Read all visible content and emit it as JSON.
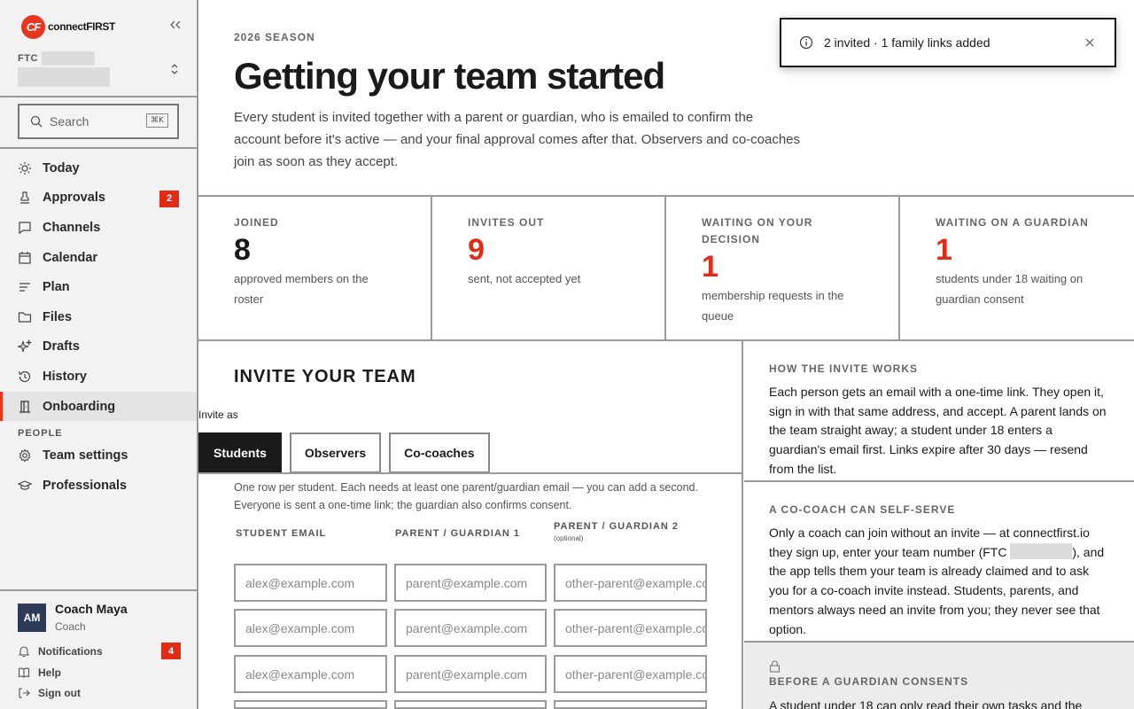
{
  "brand": {
    "name": "connectFIRST",
    "mark": "CF"
  },
  "team": {
    "code": "FTC"
  },
  "search": {
    "placeholder": "Search",
    "shortcut": "⌘K"
  },
  "nav": {
    "items": [
      {
        "label": "Today",
        "icon": "sun-icon"
      },
      {
        "label": "Approvals",
        "icon": "stamp-icon",
        "badge": "2"
      },
      {
        "label": "Channels",
        "icon": "chat-icon"
      },
      {
        "label": "Calendar",
        "icon": "calendar-icon"
      },
      {
        "label": "Plan",
        "icon": "list-icon"
      },
      {
        "label": "Files",
        "icon": "folder-icon"
      },
      {
        "label": "Drafts",
        "icon": "sparkle-icon"
      },
      {
        "label": "History",
        "icon": "history-icon"
      },
      {
        "label": "Onboarding",
        "icon": "door-icon",
        "active": true
      }
    ],
    "people_section": "PEOPLE",
    "people_items": [
      {
        "label": "Team settings",
        "icon": "gear-icon"
      },
      {
        "label": "Professionals",
        "icon": "graduation-cap-icon"
      }
    ]
  },
  "user": {
    "initials": "AM",
    "name": "Coach Maya",
    "role": "Coach"
  },
  "utility": {
    "notifications": {
      "label": "Notifications",
      "badge": "4"
    },
    "help": "Help",
    "sign_out": "Sign out"
  },
  "page": {
    "season": "2026 SEASON",
    "title": "Getting your team started",
    "intro": "Every student is invited together with a parent or guardian, who is emailed to confirm the account before it's active — and your final approval comes after that. Observers and co-coaches join as soon as they accept."
  },
  "toast": {
    "message": "2 invited · 1 family links added"
  },
  "stats": [
    {
      "label": "JOINED",
      "value": "8",
      "desc": "approved members on the roster",
      "highlight": false
    },
    {
      "label": "INVITES OUT",
      "value": "9",
      "desc": "sent, not accepted yet",
      "highlight": true
    },
    {
      "label": "WAITING ON YOUR DECISION",
      "value": "1",
      "desc": "membership requests in the queue",
      "highlight": true
    },
    {
      "label": "WAITING ON A GUARDIAN",
      "value": "1",
      "desc": "students under 18 waiting on guardian consent",
      "highlight": true
    }
  ],
  "invite": {
    "title": "INVITE YOUR TEAM",
    "invite_as": "Invite as",
    "tabs": [
      "Students",
      "Observers",
      "Co-coaches"
    ],
    "active_tab": "Students",
    "help": "One row per student. Each needs at least one parent/guardian email — you can add a second. Everyone is sent a one-time link; the guardian also confirms consent.",
    "columns": [
      "STUDENT EMAIL",
      "PARENT / GUARDIAN 1",
      "PARENT / GUARDIAN 2"
    ],
    "optional_note": "(optional)",
    "placeholders": {
      "student": "alex@example.com",
      "guardian1": "parent@example.com",
      "guardian2": "other-parent@example.com"
    }
  },
  "side": {
    "how_title": "HOW THE INVITE WORKS",
    "how_text": "Each person gets an email with a one-time link. They open it, sign in with that same address, and accept. A parent lands on the team straight away; a student under 18 enters a guardian's email first. Links expire after 30 days — resend from the list.",
    "cocoach_title": "A CO-COACH CAN SELF-SERVE",
    "cocoach_text_1": "Only a coach can join without an invite — at connectfirst.io they sign up, enter your team number (FTC",
    "cocoach_text_2": "), and the app tells them your team is already claimed and to ask you for a co-coach invite instead. Students, parents, and mentors always need an invite from you; they never see that option.",
    "guardian_title": "BEFORE A GUARDIAN CONSENTS",
    "guardian_text": "A student under 18 can only read their own tasks and the"
  },
  "colors": {
    "accent": "#e02b16",
    "ink": "#1a1a1a",
    "border": "#9a9a9a",
    "sidebar": "#f2f2f2"
  }
}
